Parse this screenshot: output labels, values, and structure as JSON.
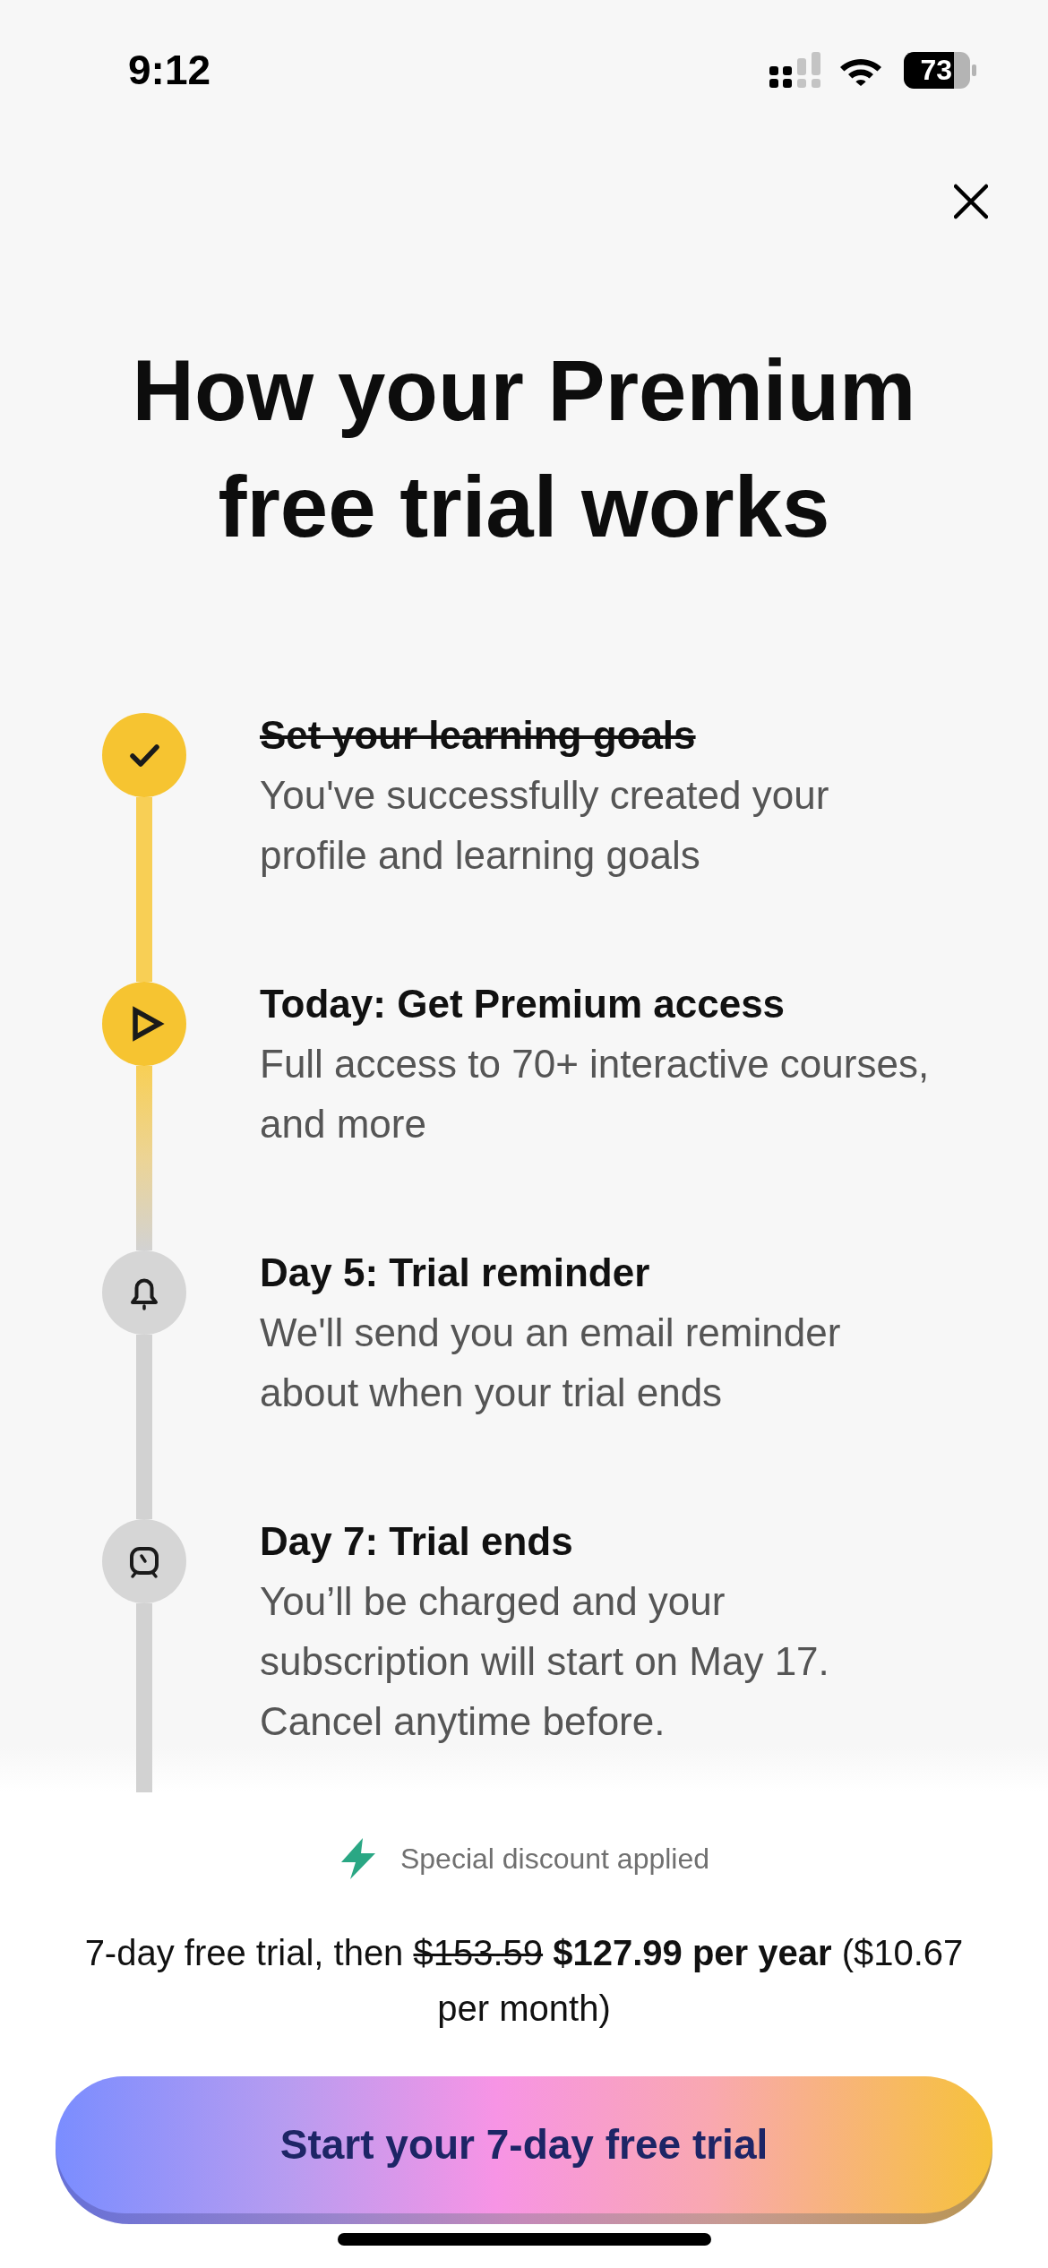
{
  "status_bar": {
    "time": "9:12",
    "battery": "73"
  },
  "title": "How your Premium free trial works",
  "steps": [
    {
      "kind": "goals",
      "completed": true,
      "active": false,
      "title": "Set your learning goals",
      "description": "You've successfully created your profile and learning goals"
    },
    {
      "kind": "access",
      "completed": false,
      "active": true,
      "title": "Today: Get Premium access",
      "description": "Full access to 70+ interactive courses, and more"
    },
    {
      "kind": "reminder",
      "completed": false,
      "active": false,
      "title": "Day 5: Trial reminder",
      "description": "We'll send you an email reminder about when your trial ends"
    },
    {
      "kind": "end",
      "completed": false,
      "active": false,
      "title": "Day 7: Trial ends",
      "description": "You’ll be charged and your subscription will start on May 17. Cancel anytime before."
    }
  ],
  "offer": {
    "badge": "Special discount applied",
    "price_lead": "7-day free trial, then",
    "old_price": "$153.59",
    "price": "$127.99 per year",
    "price_tail": "($10.67 per month)"
  },
  "cta_button": {
    "label": "Start your 7-day free trial"
  }
}
